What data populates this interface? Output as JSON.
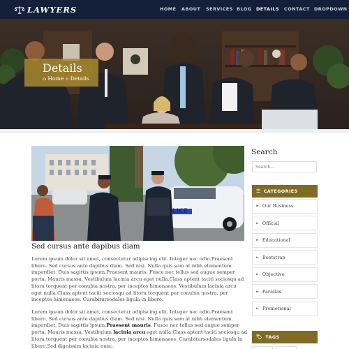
{
  "navbar": {
    "brand": "LAWYERS",
    "brand_icon": "scales-of-justice-icon",
    "items": [
      {
        "label": "HOME",
        "active": false
      },
      {
        "label": "ABOUT",
        "active": false
      },
      {
        "label": "SERVICES",
        "active": false
      },
      {
        "label": "BLOG",
        "active": false
      },
      {
        "label": "DETAILS",
        "active": true
      },
      {
        "label": "CONTACT",
        "active": false
      },
      {
        "label": "DROPDOWN",
        "active": false,
        "has_caret": true
      }
    ],
    "colors": {
      "background": "#14203a",
      "text": "#cfd4df",
      "active": "#ffffff"
    }
  },
  "hero": {
    "title": "Details",
    "breadcrumb_home": "Home",
    "breadcrumb_separator": "»",
    "breadcrumb_current": "Details",
    "home_icon": "home-icon",
    "label_color": "#ac8c2d"
  },
  "post": {
    "title": "Sed cursus ante dapibus diam",
    "paragraph_1": "Lorem ipsum dolor sit amet, consectetur adipiscing elit. Integer nec odio.Praesent libero. Sed cursus ante dapibus diam. Sed nisi. Nulla quis sem at nibh elementum imperdiet. Duis sagittis ipsum.Praesent mauris. Fusce nec tellus sed augue semper porta. Mauris massa. Vestibulum lacinia arcu eget nulla.Class aptent taciti sociosqu ad litora torquent per conubia nostra, per inceptos himenaeos. Vestibulum lacinia arcu eget nulla.Class aptent taciti sociosqu ad litora torquent per conubia nostra, per inceptos himenaeos. Curabitursodales ligula in libero.",
    "paragraph_2_a": "Lorem ipsum dolor sit amet, consectetur adipiscing elit. Integer nec odio.Praesent libero. Sed cursus ante dapibus diam. Sed nisi. Nulla quis sem at nibh elementum imperdiet. Duis sagittis ipsum.",
    "paragraph_2_bold_1": "Praesent mauris",
    "paragraph_2_b": ". Fusce nec tellus sed augue semper porta. Mauris massa. Vestibulum ",
    "paragraph_2_bold_2": "lacinia arcu",
    "paragraph_2_c": " eget nulla.Class aptent taciti sociosqu ad litora torquent per conubia nostra, per inceptos himenaeos. Curabitursodales ligula in libero.Sed dignissim lacinia nunc."
  },
  "sidebar": {
    "search_title": "Search",
    "search_placeholder": "Search...",
    "categories_title": "CATEGORIES",
    "categories_icon": "list-icon",
    "categories": [
      "Our Business",
      "Official",
      "Educational",
      "Bootstrap",
      "Objective",
      "Parallax",
      "Promotional"
    ],
    "tags_title": "TAGS",
    "tags_icon": "tag-icon",
    "accent_color": "#816b24"
  }
}
